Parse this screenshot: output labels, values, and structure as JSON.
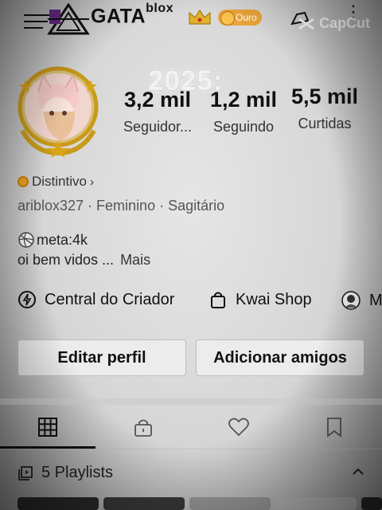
{
  "header": {
    "brand": "GATA",
    "brand_sup": "blox",
    "tier_badge": "Ouro",
    "watermark": "CapCut",
    "icons": [
      "menu-icon",
      "logo-icon",
      "crown-icon",
      "camera-icon",
      "more-icon"
    ]
  },
  "overlay_text": "2025:",
  "stats": [
    {
      "value": "3,2 mil",
      "label": "Seguidor..."
    },
    {
      "value": "1,2 mil",
      "label": "Seguindo"
    },
    {
      "value": "5,5 mil",
      "label": "Curtidas"
    }
  ],
  "profile": {
    "badge_label": "Distintivo",
    "badge_chevron": "›",
    "meta": "ariblox327 · Feminino · Sagitário",
    "bio_line1": "meta:4k",
    "bio_line2": "oi bem vidos ...",
    "bio_more": "Mais"
  },
  "shortcuts": [
    {
      "label": "Central do Criador",
      "icon": "lightning-icon"
    },
    {
      "label": "Kwai Shop",
      "icon": "shopping-bag-icon"
    },
    {
      "label": "M",
      "icon": "avatar-icon"
    }
  ],
  "buttons": {
    "edit": "Editar perfil",
    "add_friends": "Adicionar amigos"
  },
  "tabs": [
    {
      "name": "grid",
      "icon": "grid-icon",
      "active": true
    },
    {
      "name": "private",
      "icon": "lock-icon",
      "active": false
    },
    {
      "name": "likes",
      "icon": "heart-icon",
      "active": false
    },
    {
      "name": "saved",
      "icon": "bookmark-icon",
      "active": false
    }
  ],
  "playlists": {
    "label": "5 Playlists",
    "icon": "playlist-icon"
  },
  "colors": {
    "gold": "#d9a417",
    "badge_orange": "#e8a021",
    "ouro_bg": "#e9a43a"
  }
}
